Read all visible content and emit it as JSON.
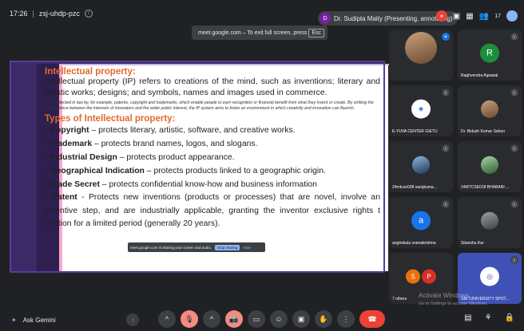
{
  "topbar": {
    "time": "17:26",
    "meeting_code": "zsj-uhdp-pzc",
    "presenter_initial": "D",
    "presenter_label": "Dr. Sudipta Maity (Presenting, annotating)",
    "participant_count": "17"
  },
  "fullscreen_banner": {
    "text": "meet.google.com – To exit full screen, press",
    "key": "Esc"
  },
  "slide": {
    "heading1": "Intellectual property:",
    "para1": "Intellectual property (IP) refers to creations of the mind, such as inventions; literary and artistic works; designs; and symbols, names and images used in commerce.",
    "small": "IP is protected in law by, for example, patents, copyright and trademarks, which enable people to earn recognition or financial benefit from what they invent or create. By striking the right balance between the interests of innovators and the wider public interest, the IP system aims to foster an environment in which creativity and innovation can flourish.",
    "heading2": "Types of Intellectual property:",
    "bullets": [
      {
        "term": "Copyright",
        "text": " – protects literary, artistic, software, and creative works."
      },
      {
        "term": "Trademark",
        "text": " – protects brand names, logos, and slogans."
      },
      {
        "term": "Industrial Design",
        "text": " – protects product appearance."
      },
      {
        "term": "Geographical Indication",
        "text": " – protects products linked to a geographic origin."
      },
      {
        "term": "Trade Secret",
        "text": " – protects confidential know-how and business information"
      },
      {
        "term": "Patent",
        "text": " -  Protects new inventions (products or processes) that are novel, involve an inventive step, and are industrially applicable, granting the inventor exclusive rights t                                        vention for a limited period (generally 20 years)."
      }
    ]
  },
  "share_bar": {
    "text": "meet.google.com is sharing your screen and audio.",
    "stop": "Stop sharing",
    "hide": "Hide"
  },
  "tiles": [
    {
      "name": "",
      "initial": "",
      "color": "#5f6368"
    },
    {
      "name": "Raghvendra Agrawal",
      "initial": "R",
      "color": "#1e8e3e"
    },
    {
      "name": "E-YUVA CENTER GIETU",
      "initial": "",
      "color": "#1a73e8"
    },
    {
      "name": "Dr. Bidush Kumar Sahoo",
      "initial": "",
      "color": "#b06000"
    },
    {
      "name": "24mtcse038 sarojkuma...",
      "initial": "",
      "color": "#1967d2"
    },
    {
      "name": "24MTCSE018 BHABANI ...",
      "initial": "",
      "color": "#5f6368"
    },
    {
      "name": "angirekula vramakrishna",
      "initial": "a",
      "color": "#1a73e8"
    },
    {
      "name": "Sitanshu Kar",
      "initial": "",
      "color": "#5f6368"
    },
    {
      "name": "7 others",
      "initial": "S P",
      "color": "#d93025"
    },
    {
      "name": "GIETUNIVERSITY SPOT...",
      "initial": "",
      "color": "#5c6bc0"
    }
  ],
  "watermark": {
    "line1": "Activate Windows",
    "line2": "Go to Settings to activate Windows."
  },
  "bottombar": {
    "gemini_label": "Ask Gemini"
  }
}
